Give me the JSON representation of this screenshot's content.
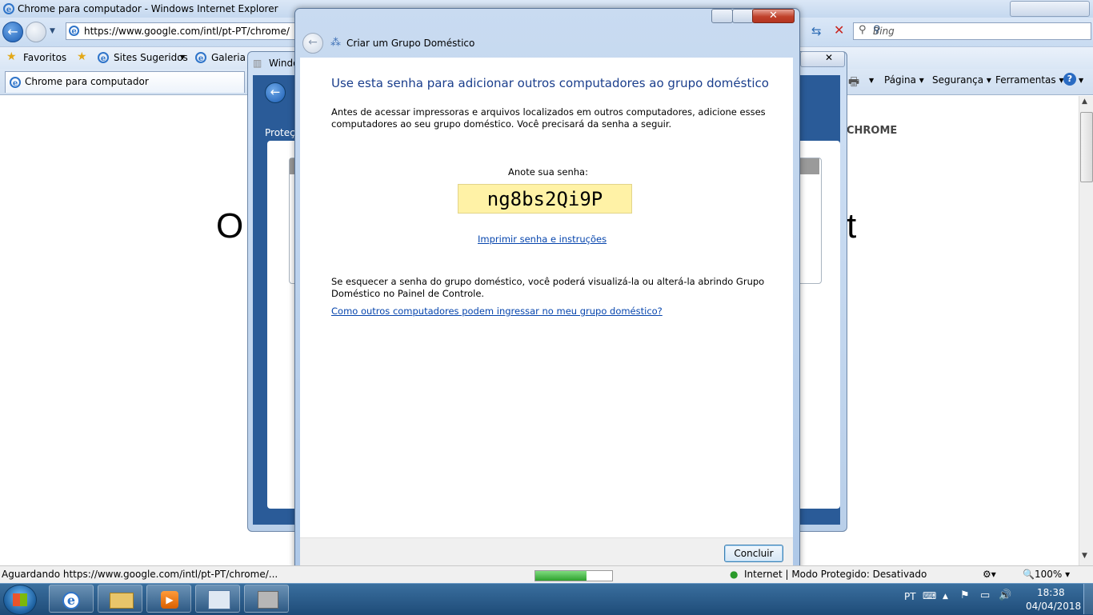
{
  "browser": {
    "window_title": "Chrome para computador - Windows Internet Explorer",
    "address": "https://www.google.com/intl/pt-PT/chrome/",
    "search_placeholder": "Bing",
    "favorites_label": "Favoritos",
    "suggested_sites": "Sites Sugeridos",
    "gallery": "Galeria d",
    "tab_title": "Chrome para computador",
    "menu": [
      "Página",
      "Segurança",
      "Ferramentas"
    ],
    "status_text": "Aguardando https://www.google.com/intl/pt-PT/chrome/...",
    "status_right": "Internet | Modo Protegido: Desativado",
    "zoom": "100%"
  },
  "page_content": {
    "big_left": "O",
    "big_right": "t",
    "chrome_label": "CHROME"
  },
  "background_window": {
    "title": "Windo",
    "section": "Proteçã"
  },
  "dialog": {
    "title": "Criar um Grupo Doméstico",
    "heading": "Use esta senha para adicionar outros computadores ao grupo doméstico",
    "intro_line1": "Antes de acessar impressoras e arquivos localizados em outros computadores, adicione esses",
    "intro_line2": "computadores ao seu grupo doméstico. Você precisará da senha a seguir.",
    "password_label": "Anote sua senha:",
    "password": "ng8bs2Qi9P",
    "print_link": "Imprimir senha e instruções",
    "forget_line1": "Se esquecer a senha do grupo doméstico, você poderá visualizá-la ou alterá-la abrindo Grupo",
    "forget_line2": "Doméstico no Painel de Controle.",
    "help_link": "Como outros computadores podem ingressar no meu grupo doméstico?",
    "finish_button": "Concluir",
    "close_glyph": "✕"
  },
  "taskbar": {
    "language": "PT",
    "time": "18:38",
    "date": "04/04/2018"
  }
}
